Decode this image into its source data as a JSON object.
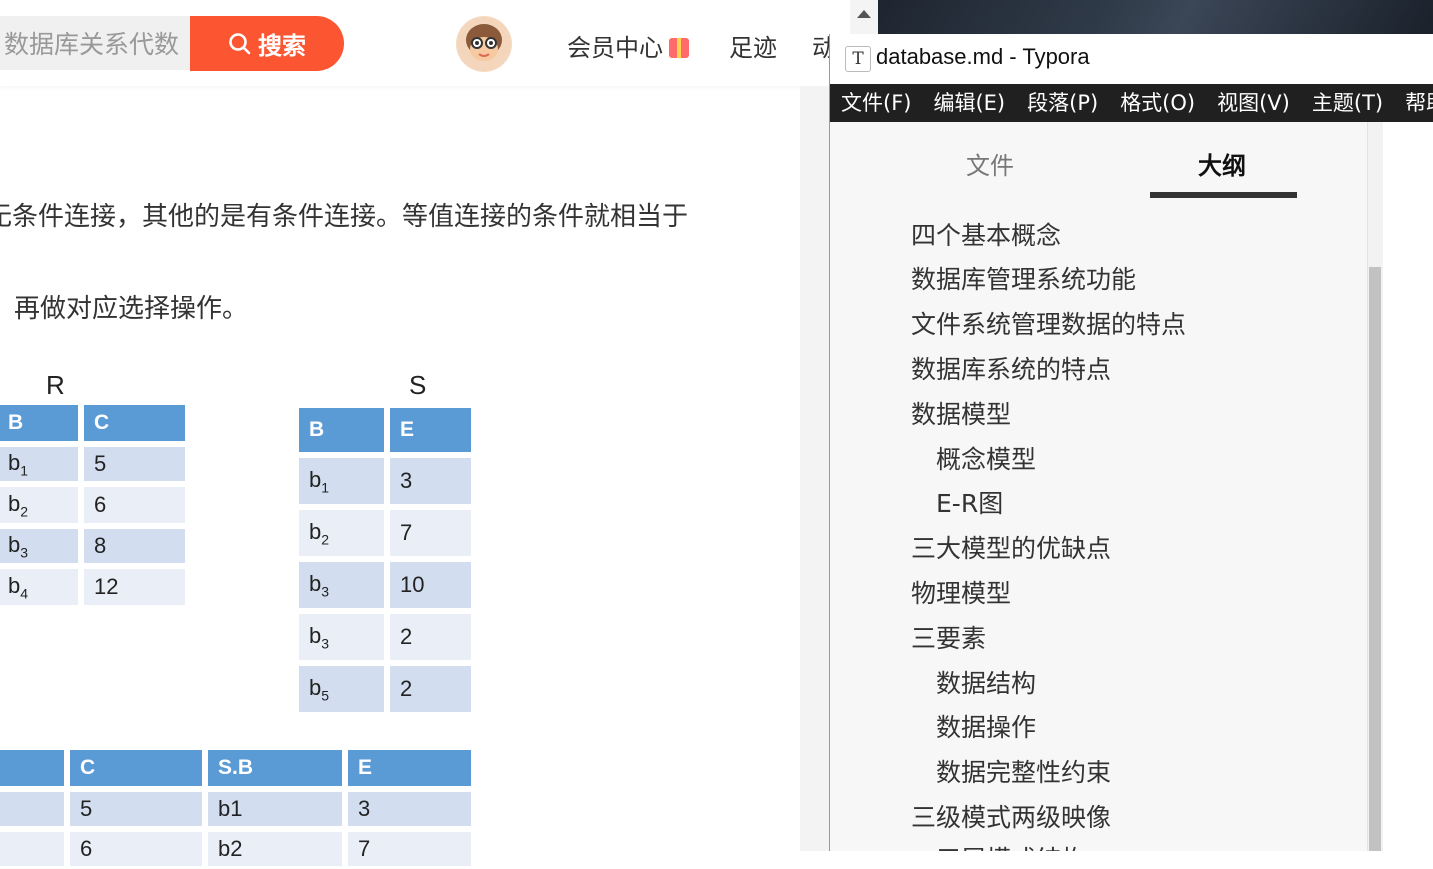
{
  "blog": {
    "search_value": "数据库关系代数",
    "search_button": "搜索",
    "nav": [
      "会员中心",
      "足迹",
      "动"
    ],
    "para1": "无条件连接，其他的是有条件连接。等值连接的条件就相当于",
    "para2": "再做对应选择操作。",
    "table_r": {
      "label": "R",
      "headers": [
        "B",
        "C"
      ],
      "rows": [
        [
          "b",
          "1",
          "5"
        ],
        [
          "b",
          "2",
          "6"
        ],
        [
          "b",
          "3",
          "8"
        ],
        [
          "b",
          "4",
          "12"
        ]
      ]
    },
    "table_s": {
      "label": "S",
      "headers": [
        "B",
        "E"
      ],
      "rows": [
        [
          "b",
          "1",
          "3"
        ],
        [
          "b",
          "2",
          "7"
        ],
        [
          "b",
          "3",
          "10"
        ],
        [
          "b",
          "3",
          "2"
        ],
        [
          "b",
          "5",
          "2"
        ]
      ]
    },
    "table_join": {
      "headers": [
        "",
        "C",
        "S.B",
        "E"
      ],
      "rows": [
        [
          "",
          "5",
          "b1",
          "3"
        ],
        [
          "",
          "6",
          "b2",
          "7"
        ]
      ]
    }
  },
  "typora": {
    "window_title": "database.md - Typora",
    "app_icon_letter": "T",
    "menu": [
      "文件(F)",
      "编辑(E)",
      "段落(P)",
      "格式(O)",
      "视图(V)",
      "主题(T)",
      "帮助("
    ],
    "tabs": {
      "files": "文件",
      "outline": "大纲"
    },
    "outline": [
      "四个基本概念",
      "数据库管理系统功能",
      "文件系统管理数据的特点",
      "数据库系统的特点",
      "数据模型",
      "概念模型",
      "E-R图",
      "三大模型的优缺点",
      "物理模型",
      "三要素",
      "数据结构",
      "数据操作",
      "数据完整性约束",
      "三级模式两级映像",
      "三层模式结构"
    ]
  }
}
